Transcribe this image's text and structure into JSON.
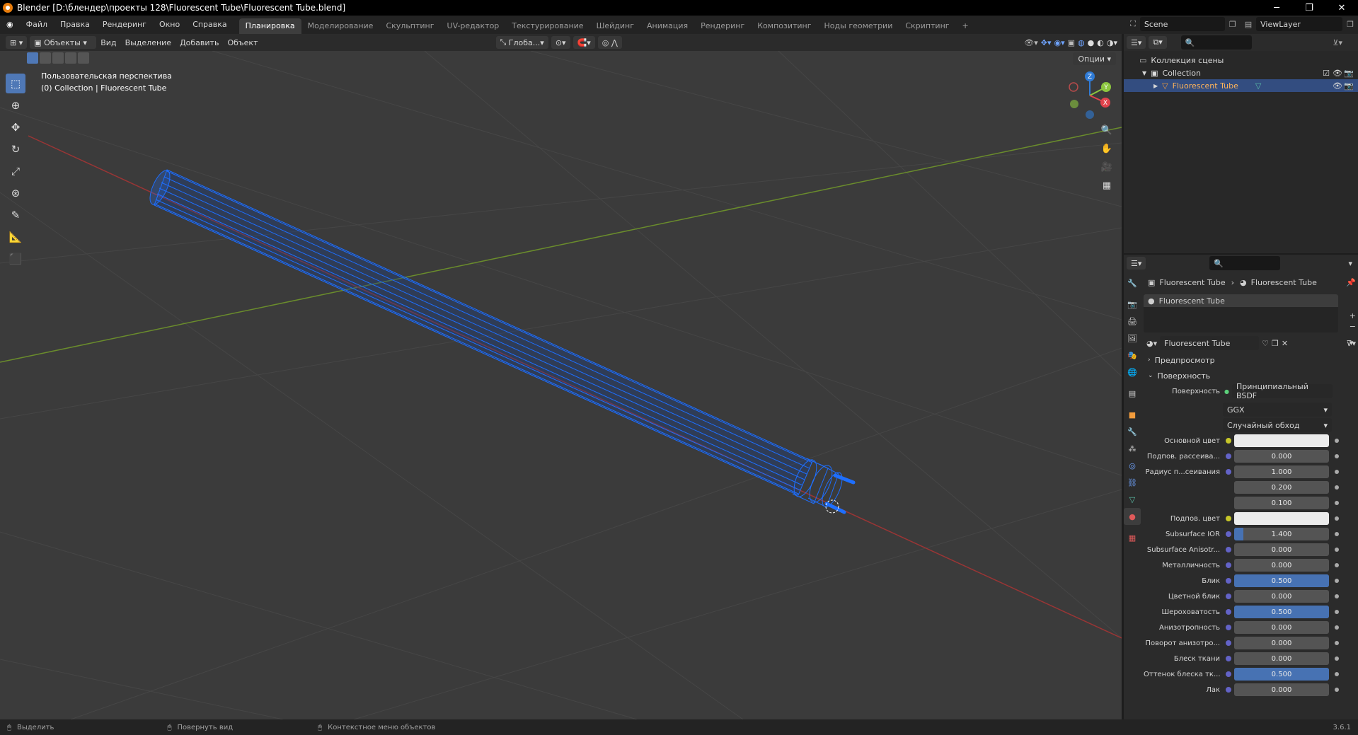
{
  "window": {
    "title": "Blender [D:\\блендер\\проекты 128\\Fluorescent Tube\\Fluorescent Tube.blend]",
    "min": "─",
    "max": "❐",
    "close": "✕"
  },
  "menus": [
    "Файл",
    "Правка",
    "Рендеринг",
    "Окно",
    "Справка"
  ],
  "workspaces": [
    "Планировка",
    "Моделирование",
    "Скульптинг",
    "UV-редактор",
    "Текстурирование",
    "Шейдинг",
    "Анимация",
    "Рендеринг",
    "Композитинг",
    "Ноды геометрии",
    "Скриптинг"
  ],
  "workspace_add": "+",
  "scene": {
    "label": "Scene",
    "view_layer": "ViewLayer"
  },
  "viewport": {
    "mode": "Объекты",
    "menus": [
      "Вид",
      "Выделение",
      "Добавить",
      "Объект"
    ],
    "orientation": "Глоба...",
    "options": "Опции",
    "info_line1": "Пользовательская перспектива",
    "info_line2": "(0) Collection | Fluorescent Tube"
  },
  "gizmo": {
    "x": "X",
    "y": "Y",
    "z": "Z"
  },
  "outliner": {
    "scene_collection": "Коллекция сцены",
    "collection": "Collection",
    "object": "Fluorescent Tube"
  },
  "properties": {
    "breadcrumb_object": "Fluorescent Tube",
    "breadcrumb_material": "Fluorescent Tube",
    "slot": "Fluorescent Tube",
    "material_name": "Fluorescent Tube",
    "preview": "Предпросмотр",
    "surface_section": "Поверхность",
    "surface_label": "Поверхность",
    "surface_value": "Принципиальный BSDF",
    "distribution": "GGX",
    "subsurface_method": "Случайный обход",
    "rows": [
      {
        "label": "Основной цвет",
        "type": "color",
        "value": ""
      },
      {
        "label": "Подпов. рассеива...",
        "type": "num",
        "value": "0.000",
        "fill": 0
      },
      {
        "label": "Радиус п...сеивания",
        "type": "num",
        "value": "1.000",
        "fill": 0
      },
      {
        "label": "",
        "type": "num",
        "value": "0.200",
        "fill": 0
      },
      {
        "label": "",
        "type": "num",
        "value": "0.100",
        "fill": 0
      },
      {
        "label": "Подпов. цвет",
        "type": "color",
        "value": ""
      },
      {
        "label": "Subsurface IOR",
        "type": "num",
        "value": "1.400",
        "fill": 0.1
      },
      {
        "label": "Subsurface Anisotr...",
        "type": "num",
        "value": "0.000",
        "fill": 0
      },
      {
        "label": "Металличность",
        "type": "num",
        "value": "0.000",
        "fill": 0
      },
      {
        "label": "Блик",
        "type": "num",
        "value": "0.500",
        "fill": 1
      },
      {
        "label": "Цветной блик",
        "type": "num",
        "value": "0.000",
        "fill": 0
      },
      {
        "label": "Шероховатость",
        "type": "num",
        "value": "0.500",
        "fill": 1
      },
      {
        "label": "Анизотропность",
        "type": "num",
        "value": "0.000",
        "fill": 0
      },
      {
        "label": "Поворот анизотро...",
        "type": "num",
        "value": "0.000",
        "fill": 0
      },
      {
        "label": "Блеск ткани",
        "type": "num",
        "value": "0.000",
        "fill": 0
      },
      {
        "label": "Оттенок блеска тк...",
        "type": "num",
        "value": "0.500",
        "fill": 1
      },
      {
        "label": "Лак",
        "type": "num",
        "value": "0.000",
        "fill": 0
      }
    ]
  },
  "status": {
    "select": "Выделить",
    "rotate": "Повернуть вид",
    "context": "Контекстное меню объектов",
    "version": "3.6.1"
  },
  "colors": {
    "accent": "#4772b3",
    "selection": "#334d80",
    "wire": "#1e6fff"
  }
}
